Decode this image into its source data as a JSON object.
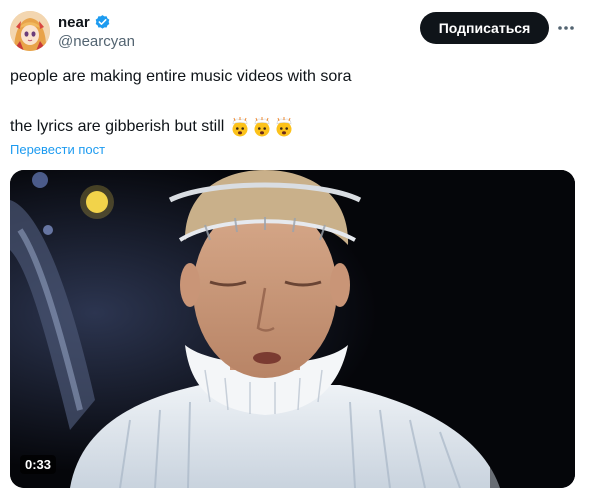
{
  "author": {
    "display_name": "near",
    "handle": "@nearcyan",
    "verified_icon": "verified-badge-icon"
  },
  "actions": {
    "follow_label": "Подписаться",
    "more_icon": "more-dots-icon"
  },
  "post": {
    "line1": "people are making entire music videos with sora",
    "line2": "the lyrics are gibberish but still",
    "emoji": [
      "exploding-head-emoji",
      "exploding-head-emoji",
      "exploding-head-emoji"
    ],
    "translate_label": "Перевести пост"
  },
  "media": {
    "type": "video",
    "duration": "0:33"
  },
  "colors": {
    "text": "#0f1419",
    "secondary": "#536471",
    "link": "#1d9bf0",
    "button_bg": "#0f1419",
    "verified": "#1d9bf0"
  }
}
